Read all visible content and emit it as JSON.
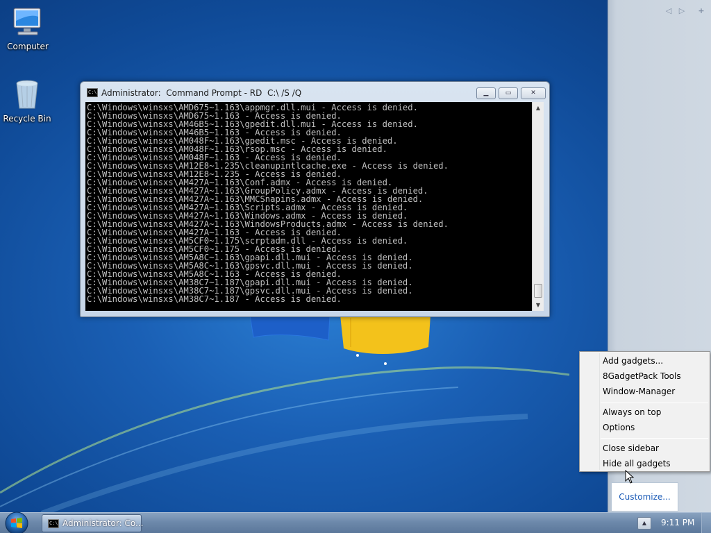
{
  "desktop": {
    "icons": [
      {
        "label": "Computer",
        "icon": "computer-icon"
      },
      {
        "label": "Recycle Bin",
        "icon": "recycle-bin-icon"
      }
    ]
  },
  "sidebar": {
    "prev_icon": "◁",
    "next_icon": "▷",
    "add_icon": "+",
    "customize_label": "Customize..."
  },
  "cmd_window": {
    "title": "Administrator:  Command Prompt - RD  C:\\ /S /Q",
    "icon_text": "C:\\",
    "minimize_glyph": "▁",
    "maximize_glyph": "▭",
    "close_glyph": "✕",
    "lines": [
      "C:\\Windows\\winsxs\\AMD675~1.163\\appmgr.dll.mui - Access is denied.",
      "C:\\Windows\\winsxs\\AMD675~1.163 - Access is denied.",
      "C:\\Windows\\winsxs\\AM46B5~1.163\\gpedit.dll.mui - Access is denied.",
      "C:\\Windows\\winsxs\\AM46B5~1.163 - Access is denied.",
      "C:\\Windows\\winsxs\\AM048F~1.163\\gpedit.msc - Access is denied.",
      "C:\\Windows\\winsxs\\AM048F~1.163\\rsop.msc - Access is denied.",
      "C:\\Windows\\winsxs\\AM048F~1.163 - Access is denied.",
      "C:\\Windows\\winsxs\\AM12E8~1.235\\cleanupintlcache.exe - Access is denied.",
      "C:\\Windows\\winsxs\\AM12E8~1.235 - Access is denied.",
      "C:\\Windows\\winsxs\\AM427A~1.163\\Conf.admx - Access is denied.",
      "C:\\Windows\\winsxs\\AM427A~1.163\\GroupPolicy.admx - Access is denied.",
      "C:\\Windows\\winsxs\\AM427A~1.163\\MMCSnapins.admx - Access is denied.",
      "C:\\Windows\\winsxs\\AM427A~1.163\\Scripts.admx - Access is denied.",
      "C:\\Windows\\winsxs\\AM427A~1.163\\Windows.admx - Access is denied.",
      "C:\\Windows\\winsxs\\AM427A~1.163\\WindowsProducts.admx - Access is denied.",
      "C:\\Windows\\winsxs\\AM427A~1.163 - Access is denied.",
      "C:\\Windows\\winsxs\\AM5CF0~1.175\\scrptadm.dll - Access is denied.",
      "C:\\Windows\\winsxs\\AM5CF0~1.175 - Access is denied.",
      "C:\\Windows\\winsxs\\AM5A8C~1.163\\gpapi.dll.mui - Access is denied.",
      "C:\\Windows\\winsxs\\AM5A8C~1.163\\gpsvc.dll.mui - Access is denied.",
      "C:\\Windows\\winsxs\\AM5A8C~1.163 - Access is denied.",
      "C:\\Windows\\winsxs\\AM38C7~1.187\\gpapi.dll.mui - Access is denied.",
      "C:\\Windows\\winsxs\\AM38C7~1.187\\gpsvc.dll.mui - Access is denied.",
      "C:\\Windows\\winsxs\\AM38C7~1.187 - Access is denied."
    ],
    "scroll_up_glyph": "▲",
    "scroll_down_glyph": "▼"
  },
  "context_menu": {
    "items": [
      "Add gadgets...",
      "8GadgetPack Tools",
      "Window-Manager",
      "Always on top",
      "Options",
      "Close sidebar",
      "Hide all gadgets"
    ]
  },
  "taskbar": {
    "task_label": "Administrator:  Co...",
    "task_icon_text": "C:\\",
    "tray_up_glyph": "▲",
    "clock": "9:11 PM"
  },
  "colors": {
    "desktop_blue": "#1a5fb4",
    "console_bg": "#000000",
    "console_fg": "#c0c0c0",
    "link_blue": "#1e5db8"
  }
}
